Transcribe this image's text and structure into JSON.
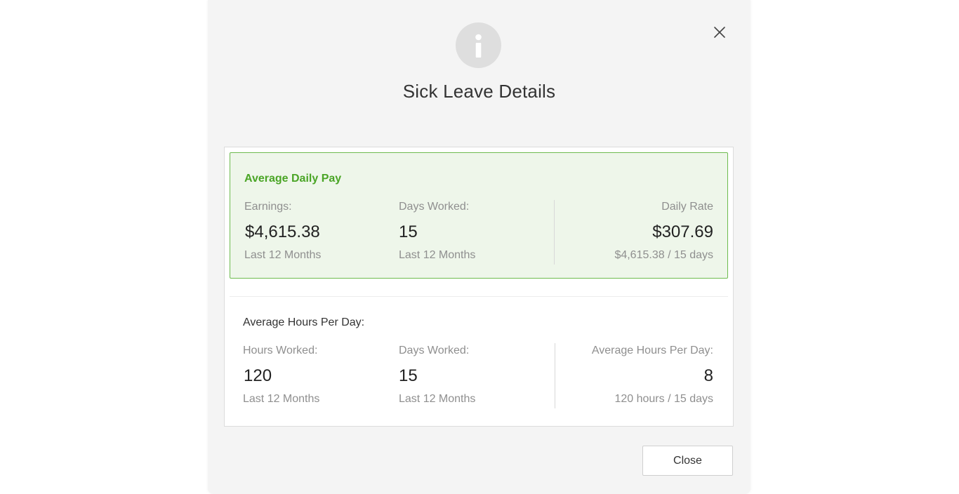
{
  "dialog": {
    "title": "Sick Leave Details",
    "info_icon": "info-icon",
    "close_icon": "close-icon",
    "close_button_label": "Close"
  },
  "average_daily_pay": {
    "heading": "Average Daily Pay",
    "earnings": {
      "label": "Earnings:",
      "value": "$4,615.38",
      "sub": "Last 12 Months"
    },
    "days_worked": {
      "label": "Days Worked:",
      "value": "15",
      "sub": "Last 12 Months"
    },
    "daily_rate": {
      "label": "Daily Rate",
      "value": "$307.69",
      "sub": "$4,615.38 / 15 days"
    }
  },
  "average_hours_per_day": {
    "heading": "Average Hours Per Day:",
    "hours_worked": {
      "label": "Hours Worked:",
      "value": "120",
      "sub": "Last 12 Months"
    },
    "days_worked": {
      "label": "Days Worked:",
      "value": "15",
      "sub": "Last 12 Months"
    },
    "avg_hours": {
      "label": "Average Hours Per Day:",
      "value": "8",
      "sub": "120 hours / 15 days"
    }
  },
  "colors": {
    "accent_green": "#4aa526",
    "green_border": "#6dbb4e",
    "green_fill": "#eef6ea",
    "modal_bg": "#f4f4f4"
  }
}
